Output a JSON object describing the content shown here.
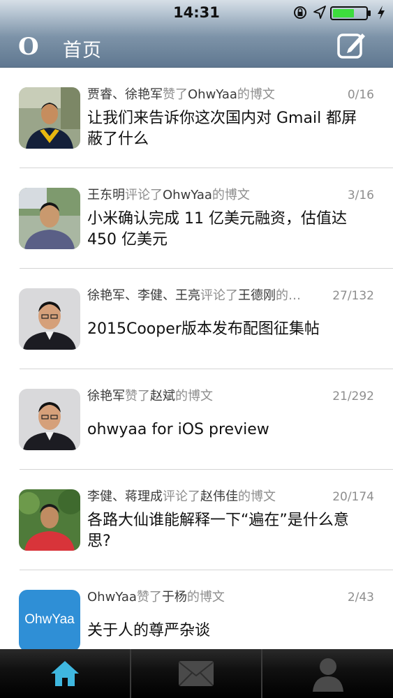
{
  "status_bar": {
    "time": "14:31"
  },
  "header": {
    "logo": "O",
    "title": "首页",
    "compose_icon": "compose-icon"
  },
  "feed": [
    {
      "users": "贾睿、徐艳军",
      "action": "赞了",
      "target": "OhwYaa",
      "suffix": "的博文",
      "count": "0/16",
      "title": "让我们来告诉你这次国内对 Gmail 都屏蔽了什么",
      "avatar": "photo-person-graduation"
    },
    {
      "users": "王东明",
      "action": "评论了",
      "target": "OhwYaa",
      "suffix": "的博文",
      "count": "3/16",
      "title": "小米确认完成 11 亿美元融资，估值达 450 亿美元",
      "avatar": "photo-person-outdoor"
    },
    {
      "users": "徐艳军、李健、王亮",
      "action": "评论了",
      "target": "王德刚",
      "suffix": "的…",
      "count": "27/132",
      "title": "2015Cooper版本发布配图征集帖",
      "avatar": "photo-person-portrait"
    },
    {
      "users": "徐艳军",
      "action": "赞了",
      "target": "赵斌",
      "suffix": "的博文",
      "count": "21/292",
      "title": "ohwyaa for iOS preview",
      "avatar": "photo-person-portrait"
    },
    {
      "users": "李健、蒋理成",
      "action": "评论了",
      "target": "赵伟佳",
      "suffix": "的博文",
      "count": "20/174",
      "title": "各路大仙谁能解释一下“遍在”是什么意思?",
      "avatar": "photo-person-garden"
    },
    {
      "users": "OhwYaa",
      "action": "赞了",
      "target": "于杨",
      "suffix": "的博文",
      "count": "2/43",
      "title": "关于人的尊严杂谈",
      "avatar": "ohwyaa-logo",
      "avatar_text": "OhwYaa"
    }
  ],
  "tabbar": {
    "active": "home",
    "tabs": [
      "home-icon",
      "messages-icon",
      "profile-icon"
    ]
  },
  "colors": {
    "header_top": "#b9c7d4",
    "header_bottom": "#5f7790",
    "home_active": "#3fb7df",
    "ohwyaa_blue": "#2f8fd6"
  }
}
